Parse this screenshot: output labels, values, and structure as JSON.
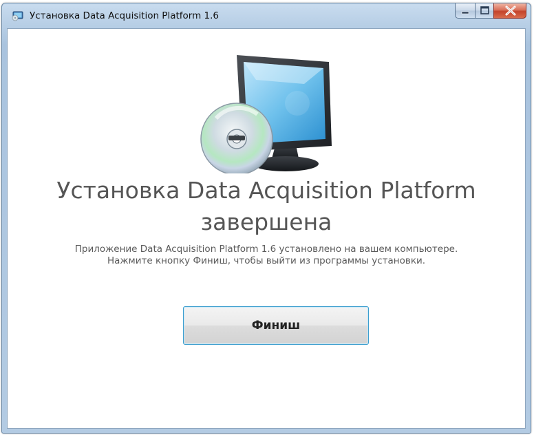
{
  "window": {
    "title": "Установка Data Acquisition Platform 1.6",
    "icon": "setup-app-icon"
  },
  "title_controls": {
    "minimize_icon": "minimize-icon",
    "maximize_icon": "maximize-icon",
    "close_icon": "close-icon",
    "close_color": "#c4432b"
  },
  "content": {
    "hero_image": "monitor-cd-icon",
    "heading": "Установка Data Acquisition Platform завершена",
    "message_line1": "Приложение Data Acquisition Platform 1.6 установлено на вашем компьютере.",
    "message_line2": "Нажмите кнопку Финиш, чтобы выйти из программы установки."
  },
  "buttons": {
    "finish_label": "Финиш"
  },
  "colors": {
    "accent_border": "#3c9ecf",
    "heading_text": "#555555"
  }
}
